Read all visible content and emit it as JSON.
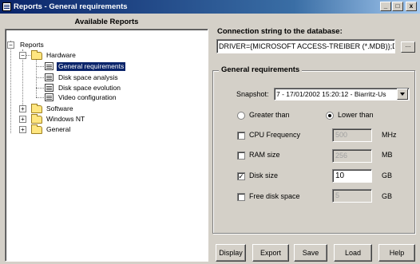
{
  "window": {
    "title": "Reports - General requirements",
    "minimize": "_",
    "maximize": "□",
    "close": "x"
  },
  "left_panel": {
    "header": "Available Reports",
    "tree": {
      "root": "Reports",
      "hardware": "Hardware",
      "hardware_items": [
        "General requirements",
        "Disk space analysis",
        "Disk space evolution",
        "Video configuration"
      ],
      "software": "Software",
      "windows_nt": "Windows NT",
      "general": "General"
    }
  },
  "connection": {
    "label": "Connection string to the database:",
    "value": "DRIVER={MICROSOFT ACCESS-TREIBER (*.MDB)};D",
    "browse_label": "..."
  },
  "group": {
    "title": "General requirements",
    "snapshot_label": "Snapshot:",
    "snapshot_value": "7 - 17/01/2002 15:20:12 - Biarritz-Us",
    "greater_than": "Greater than",
    "lower_than": "Lower than",
    "criteria": [
      {
        "label": "CPU Frequency",
        "checked": "",
        "value": "500",
        "unit": "MHz"
      },
      {
        "label": "RAM size",
        "checked": "",
        "value": "256",
        "unit": "MB"
      },
      {
        "label": "Disk size",
        "checked": "✓",
        "value": "10",
        "unit": "GB"
      },
      {
        "label": "Free disk space",
        "checked": "",
        "value": "5",
        "unit": "GB"
      }
    ]
  },
  "buttons": {
    "display": "Display",
    "export": "Export",
    "save": "Save",
    "load": "Load",
    "help": "Help"
  }
}
